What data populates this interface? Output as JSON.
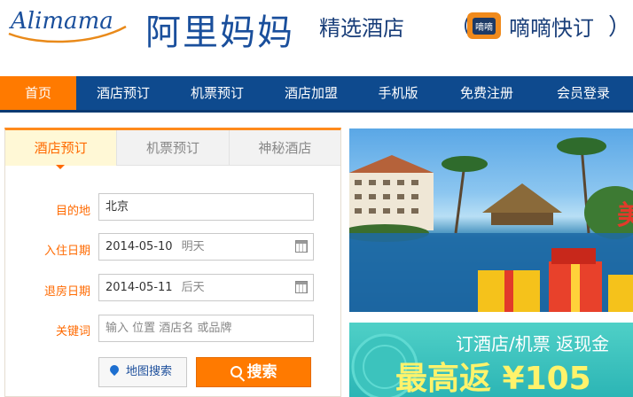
{
  "header": {
    "logo_text": "Alimama",
    "brand": "阿里妈妈",
    "subtitle": "精选酒店",
    "paren_left": "（",
    "didi_icon_label": "嘀嘀",
    "didi_text": "嘀嘀快订",
    "paren_right": "）"
  },
  "nav": {
    "items": [
      {
        "label": "首页",
        "active": true
      },
      {
        "label": "酒店预订"
      },
      {
        "label": "机票预订"
      },
      {
        "label": "酒店加盟"
      },
      {
        "label": "手机版"
      },
      {
        "label": "免费注册"
      },
      {
        "label": "会员登录"
      }
    ]
  },
  "booking": {
    "tabs": [
      {
        "label": "酒店预订",
        "active": true
      },
      {
        "label": "机票预订"
      },
      {
        "label": "神秘酒店"
      }
    ],
    "destination": {
      "label": "目的地",
      "value": "北京"
    },
    "checkin": {
      "label": "入住日期",
      "value": "2014-05-10",
      "hint": "明天"
    },
    "checkout": {
      "label": "退房日期",
      "value": "2014-05-11",
      "hint": "后天"
    },
    "keyword": {
      "label": "关键词",
      "placeholder": "输入 位置 酒店名 或品牌"
    },
    "map_button": "地图搜索",
    "search_button": "搜索"
  },
  "banner2": {
    "line1": "订酒店/机票  返现金",
    "line2": "最高返 ¥105"
  },
  "colors": {
    "nav_bg": "#0e4a8e",
    "accent": "#ff7a00",
    "brand_blue": "#1a4f9c"
  }
}
